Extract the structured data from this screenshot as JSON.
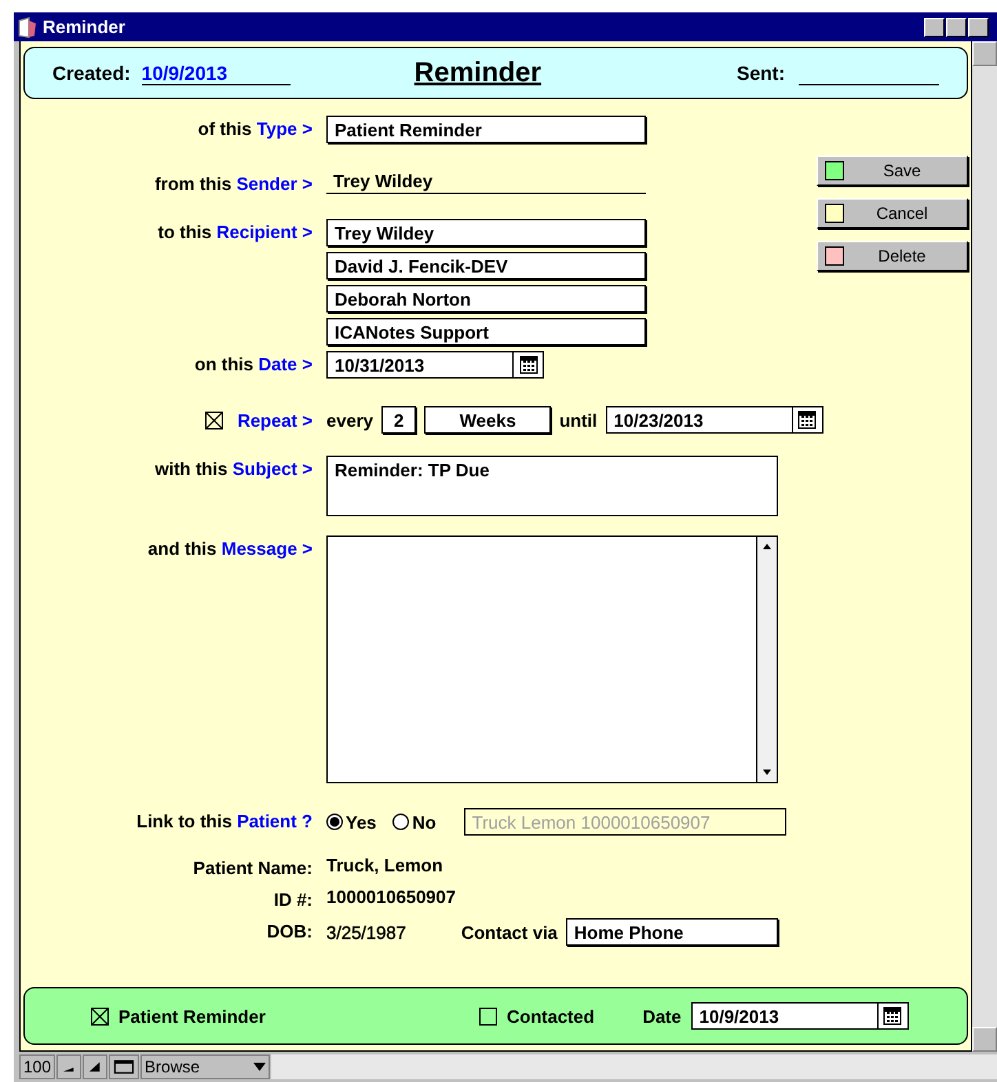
{
  "window": {
    "title": "Reminder"
  },
  "header": {
    "created_label": "Created:",
    "created": "10/9/2013",
    "title": "Reminder",
    "sent_label": "Sent:"
  },
  "type": {
    "prefix": "of this",
    "keyword": "Type >",
    "value": "Patient Reminder"
  },
  "sender": {
    "prefix": "from this",
    "keyword": "Sender >",
    "value": "Trey Wildey"
  },
  "recipient": {
    "prefix": "to this",
    "keyword": "Recipient >",
    "values": [
      "Trey Wildey",
      "David J. Fencik-DEV",
      "Deborah Norton",
      "ICANotes Support"
    ]
  },
  "date": {
    "prefix": "on this",
    "keyword": "Date >",
    "value": "10/31/2013"
  },
  "repeat": {
    "checked": true,
    "keyword": "Repeat >",
    "every_label": "every",
    "every": "2",
    "unit": "Weeks",
    "until_label": "until",
    "until": "10/23/2013"
  },
  "subject": {
    "prefix": "with this",
    "keyword": "Subject >",
    "value": "Reminder: TP Due"
  },
  "message": {
    "prefix": "and this",
    "keyword": "Message >"
  },
  "buttons": [
    {
      "label": "Save",
      "color": "#80ff80"
    },
    {
      "label": "Cancel",
      "color": "#ffffc0"
    },
    {
      "label": "Delete",
      "color": "#ffc0c0"
    }
  ],
  "link": {
    "prefix": "Link to this",
    "keyword": "Patient ?",
    "options": [
      {
        "label": "Yes",
        "selected": true
      },
      {
        "label": "No",
        "selected": false
      }
    ],
    "lookup": "Truck Lemon 1000010650907"
  },
  "patient": {
    "name_label": "Patient Name:",
    "name": "Truck, Lemon",
    "id_label": "ID #:",
    "id": "1000010650907",
    "dob_label": "DOB:",
    "dob": "3/25/1987",
    "contact_label": "Contact via",
    "contact": "Home Phone"
  },
  "footer": {
    "patient_reminder": {
      "label": "Patient Reminder",
      "checked": true
    },
    "contacted": {
      "label": "Contacted",
      "checked": false
    },
    "date_label": "Date",
    "date": "10/9/2013"
  },
  "status_bar": {
    "zoom": "100",
    "mode": "Browse"
  }
}
